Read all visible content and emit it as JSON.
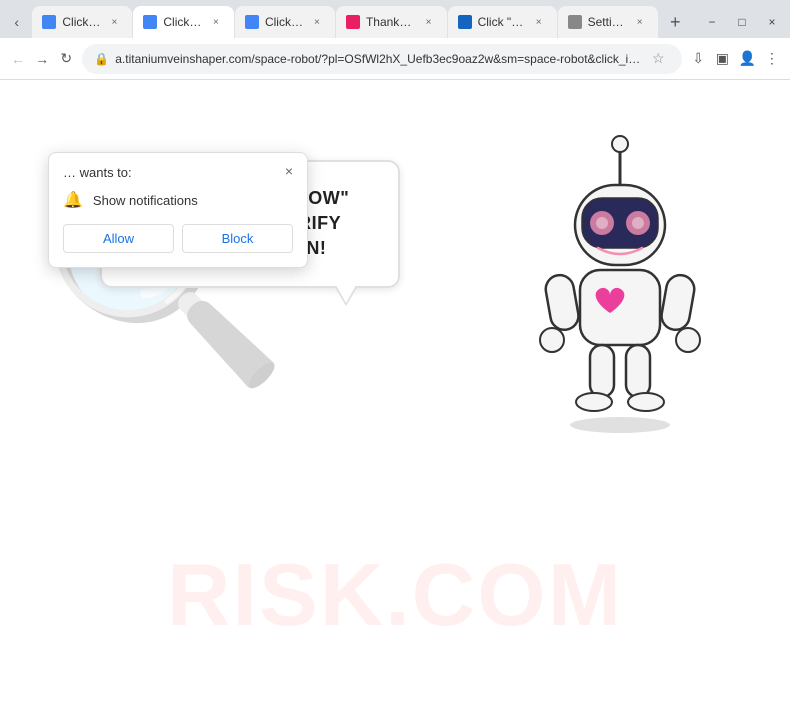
{
  "tabs": [
    {
      "id": "t1",
      "title": "Click All",
      "favicon": "blue",
      "active": false
    },
    {
      "id": "t2",
      "title": "Click \"All",
      "favicon": "blue",
      "active": true
    },
    {
      "id": "t3",
      "title": "Click All",
      "favicon": "blue",
      "active": false
    },
    {
      "id": "t4",
      "title": "Thanks f…",
      "favicon": "pink",
      "active": false
    },
    {
      "id": "t5",
      "title": "Click \"Al…",
      "favicon": "blue2",
      "active": false
    },
    {
      "id": "t6",
      "title": "Settings",
      "favicon": "gear",
      "active": false
    }
  ],
  "addressBar": {
    "url": "a.titaniumveinshaper.com/space-robot/?pl=OSfWl2hX_Uefb3ec9oaz2w&sm=space-robot&click_i…"
  },
  "notification": {
    "title": "… wants to:",
    "close_label": "×",
    "permission_label": "Show notifications",
    "allow_label": "Allow",
    "block_label": "Block"
  },
  "page": {
    "speech_line1": "PRESS THE \"ALLOW\" BUTTON TO VERIFY",
    "speech_line2": "YOU'RE HUMAN!",
    "watermark": "RISK.COM"
  },
  "window_controls": {
    "minimize": "−",
    "maximize": "□",
    "close": "×"
  }
}
